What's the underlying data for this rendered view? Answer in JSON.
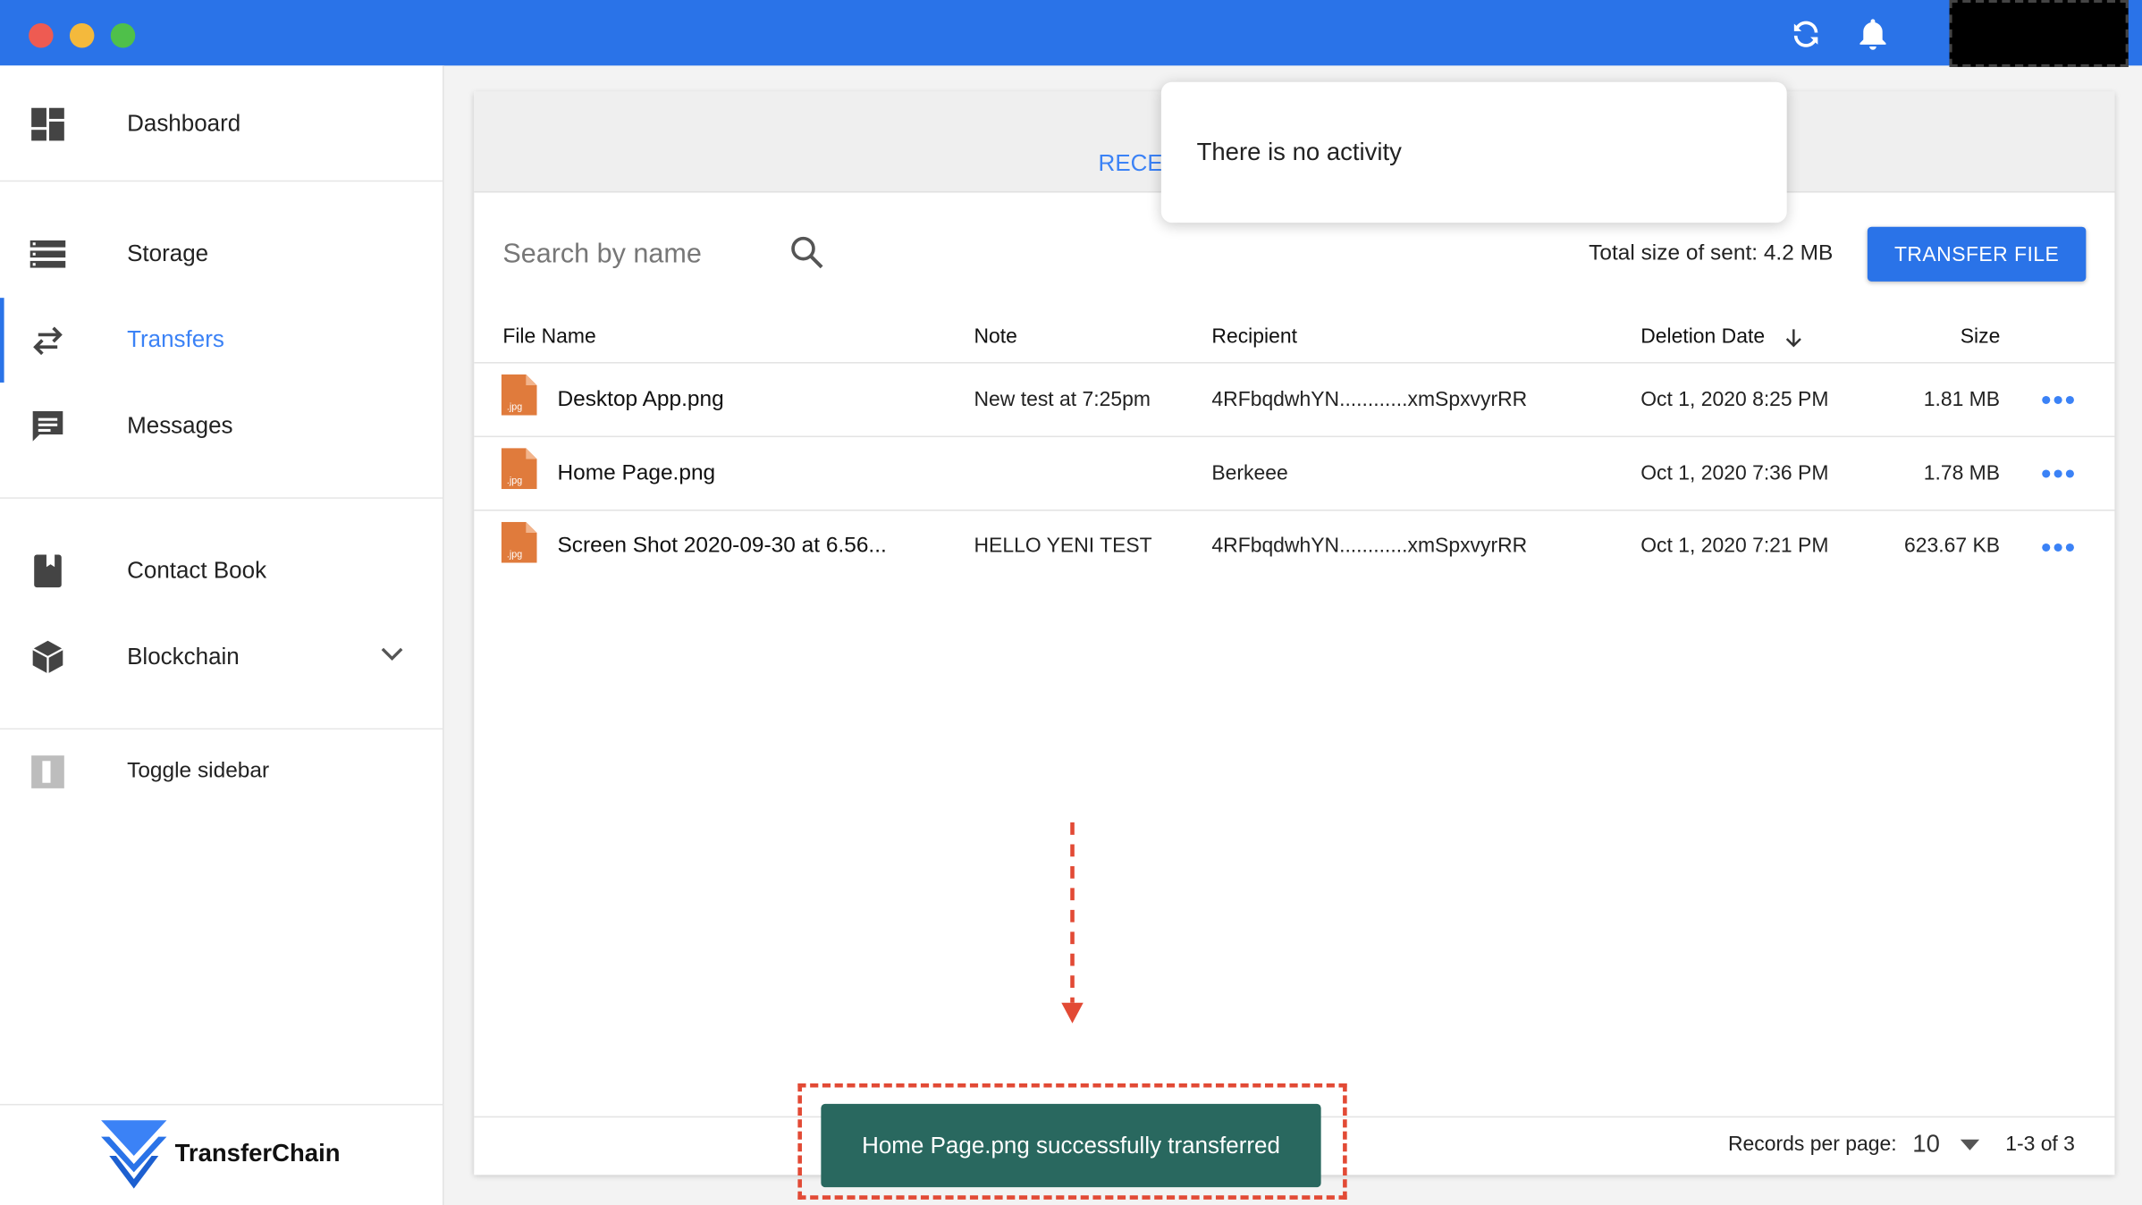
{
  "window": {
    "controls": [
      "close",
      "minimize",
      "maximize"
    ],
    "colors": {
      "titlebar": "#2a73e8",
      "accent": "#2a73e8",
      "toast": "#29685f",
      "annotation": "#e24a35"
    }
  },
  "header": {
    "icons": [
      "refresh-icon",
      "bell-icon"
    ]
  },
  "sidebar": {
    "items": [
      {
        "label": "Dashboard",
        "icon": "dashboard-icon"
      },
      {
        "label": "Storage",
        "icon": "storage-icon"
      },
      {
        "label": "Transfers",
        "icon": "transfers-icon",
        "active": true
      },
      {
        "label": "Messages",
        "icon": "messages-icon"
      },
      {
        "label": "Contact Book",
        "icon": "contact-book-icon"
      },
      {
        "label": "Blockchain",
        "icon": "blockchain-icon"
      },
      {
        "label": "Toggle sidebar",
        "icon": "toggle-sidebar-icon"
      }
    ],
    "brand": "TransferChain"
  },
  "tabs": {
    "visible": "RECE"
  },
  "notifications": {
    "empty_text": "There is no activity"
  },
  "toolbar": {
    "search_placeholder": "Search by name",
    "total_size": "Total size of sent: 4.2 MB",
    "transfer_label": "TRANSFER FILE"
  },
  "table": {
    "columns": [
      "File Name",
      "Note",
      "Recipient",
      "Deletion Date",
      "Size"
    ],
    "rows": [
      {
        "file_type": ".jpg",
        "name": "Desktop App.png",
        "note": "New test at 7:25pm",
        "recipient": "4RFbqdwhYN............xmSpxvyrRR",
        "deletion_date": "Oct 1, 2020 8:25 PM",
        "size": "1.81 MB"
      },
      {
        "file_type": ".jpg",
        "name": "Home Page.png",
        "note": "",
        "recipient": "Berkeee",
        "deletion_date": "Oct 1, 2020 7:36 PM",
        "size": "1.78 MB"
      },
      {
        "file_type": ".jpg",
        "name": "Screen Shot 2020-09-30 at 6.56...",
        "note": "HELLO YENI TEST",
        "recipient": "4RFbqdwhYN............xmSpxvyrRR",
        "deletion_date": "Oct 1, 2020 7:21 PM",
        "size": "623.67 KB"
      }
    ]
  },
  "pagination": {
    "records_label": "Records per page:",
    "records_value": "10",
    "range": "1-3 of 3"
  },
  "toast": {
    "message": "Home Page.png successfully transferred"
  }
}
